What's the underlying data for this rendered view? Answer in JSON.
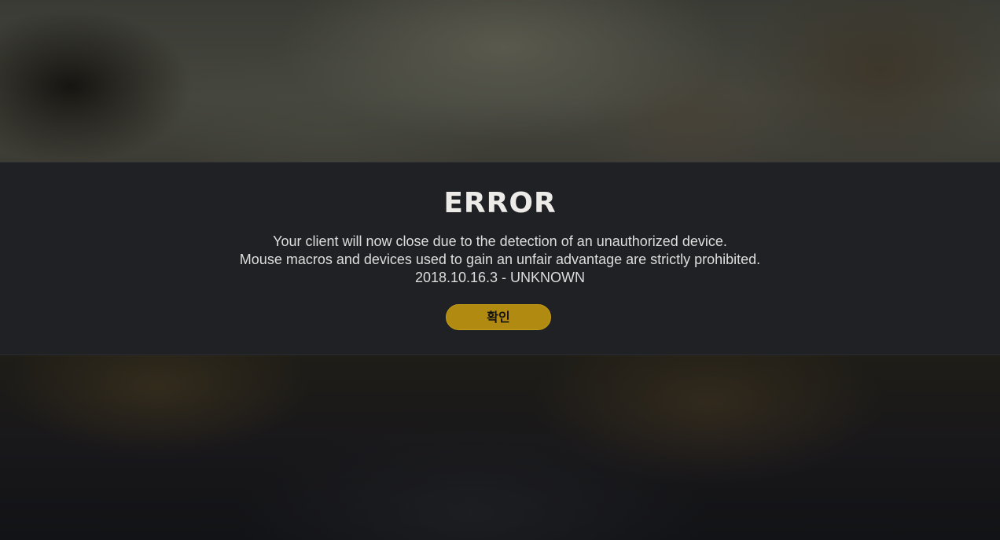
{
  "dialog": {
    "title": "ERROR",
    "message_lines": [
      "Your client will now close due to the detection of an unauthorized device.",
      "Mouse macros and devices used to gain an unfair advantage are strictly prohibited.",
      "2018.10.16.3 - UNKNOWN"
    ],
    "confirm_label": "확인"
  },
  "colors": {
    "dialog_background": "#202124",
    "accent_button": "#b08a11",
    "title_text": "#ecebe7"
  }
}
